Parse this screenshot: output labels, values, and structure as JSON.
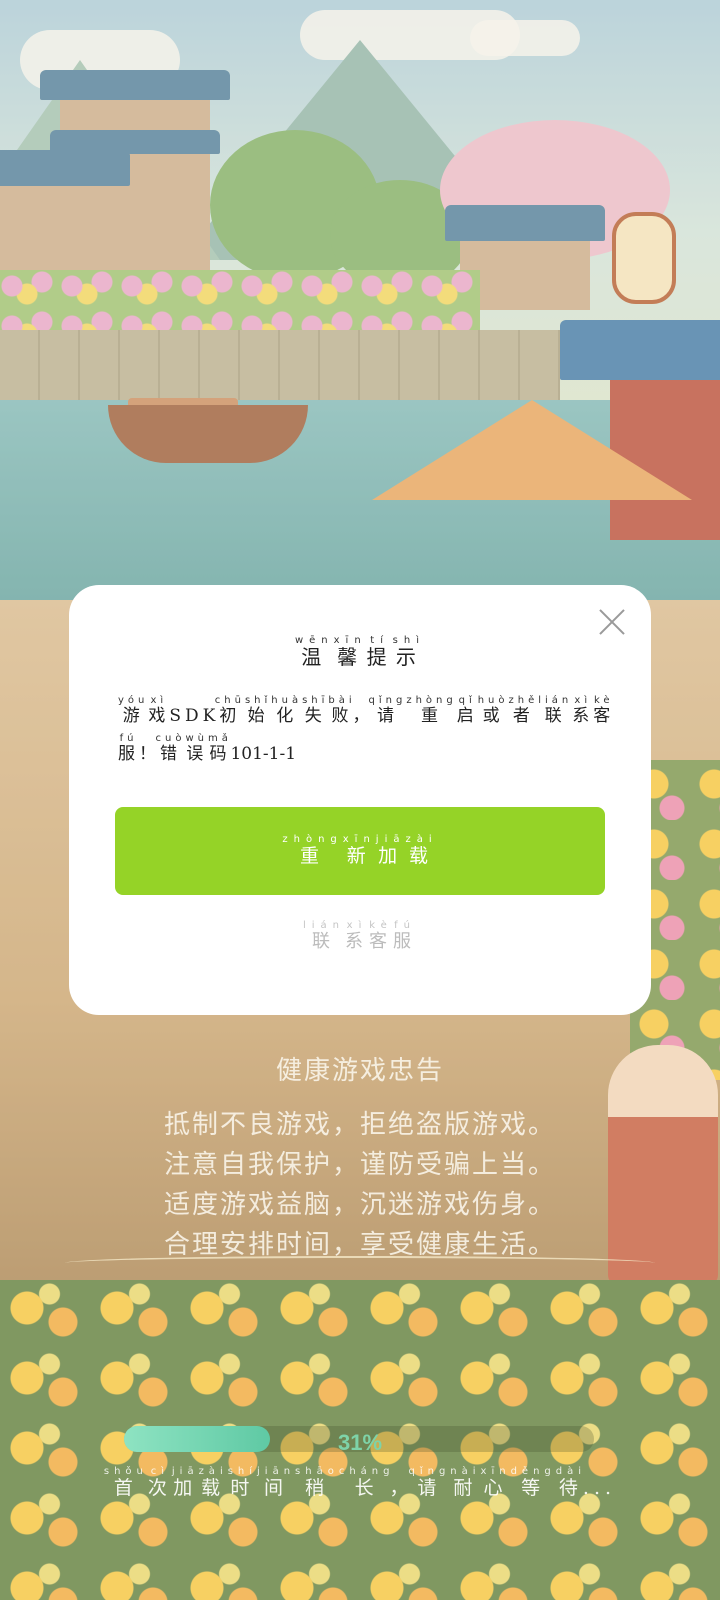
{
  "dialog": {
    "title": "温馨提示",
    "title_pinyin": [
      "wēn",
      "xīn",
      "tí",
      "shì"
    ],
    "message_part1": "游戏SDK初始化失败，请重启或者联系客服！错误码",
    "message_pinyin_visible": [
      "yóu",
      "xì",
      "chū",
      "shǐ",
      "huà",
      "shī",
      "bài",
      "qǐng",
      "zhòng",
      "qǐ",
      "huò",
      "zhě",
      "lián",
      "xì",
      "kè",
      "fú",
      "cuò",
      "wù",
      "mǎ"
    ],
    "error_code": "101-1-1",
    "reload_label": "重新加载",
    "reload_pinyin": [
      "zhòng",
      "xīn",
      "jiā",
      "zài"
    ],
    "contact_label": "联系客服",
    "contact_pinyin": [
      "lián",
      "xì",
      "kè",
      "fú"
    ],
    "close_icon": "close-icon"
  },
  "advisory": {
    "title": "健康游戏忠告",
    "lines": [
      "抵制不良游戏，拒绝盗版游戏。",
      "注意自我保护，谨防受骗上当。",
      "适度游戏益脑，沉迷游戏伤身。",
      "合理安排时间，享受健康生活。"
    ]
  },
  "loading": {
    "progress": 0.31,
    "percent_label": "31%",
    "tip": "首次加载时间稍长，请耐心等待...",
    "tip_pinyin": [
      "shǒu",
      "cì",
      "jiā",
      "zài",
      "shí",
      "jiān",
      "shāo",
      "cháng",
      "qǐng",
      "nài",
      "xīn",
      "děng",
      "dài"
    ]
  },
  "colors": {
    "reload_button": "#95d327",
    "progress_fill": "#5fc9a4",
    "percent_text": "#7ed3a8"
  }
}
